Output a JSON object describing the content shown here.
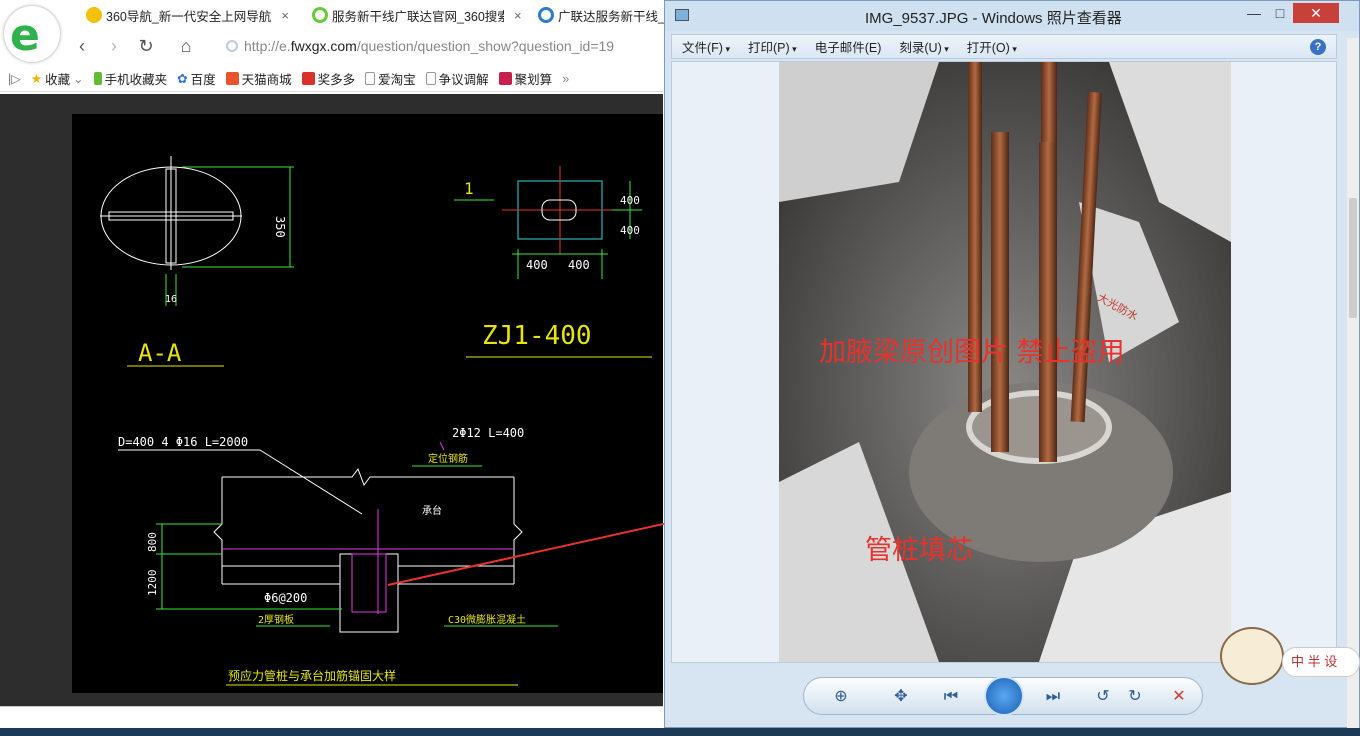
{
  "browser": {
    "tabs": [
      {
        "label": "360导航_新一代安全上网导航",
        "close": "×"
      },
      {
        "label": "服务新干线广联达官网_360搜索",
        "close": "×"
      },
      {
        "label": "广联达服务新干线_"
      }
    ],
    "address": {
      "prefix": "http://e.",
      "domain": "fwxgx.com",
      "path": "/question/question_show?question_id=19"
    },
    "bookmarks": [
      "收藏",
      "手机收藏夹",
      "百度",
      "天猫商城",
      "奖多多",
      "爱淘宝",
      "争议调解",
      "聚划算"
    ],
    "more": "»"
  },
  "cad": {
    "section_dim": "350",
    "section_width": "16",
    "section_label": "A-A",
    "marker_1": "1",
    "dims_v": [
      "400",
      "400"
    ],
    "dims_h": [
      "400",
      "400"
    ],
    "zj_label": "ZJ1-400",
    "pile_note": "D=400 4 Φ16 L=2000",
    "rebar_note": "2Φ12 L=400",
    "position_rebar": "定位钢筋",
    "cap_label": "承台",
    "h800": "800",
    "h1200": "1200",
    "stirrup": "Φ6@200",
    "plate": "2厚钢板",
    "concrete": "C30微膨胀混凝土",
    "detail_title": "预应力管桩与承台加筋锚固大样"
  },
  "viewer": {
    "title": "IMG_9537.JPG - Windows 照片查看器",
    "window_controls": {
      "min": "—",
      "max": "□",
      "close": "✕"
    },
    "menu": [
      "文件(F)",
      "打印(P)",
      "电子邮件(E)",
      "刻录(U)",
      "打开(O)"
    ],
    "help": "?",
    "watermark": "加腋梁原创图片   禁止盗用",
    "photo_label": "管桩填芯",
    "photo_sticker": "大光防水"
  },
  "mascot": {
    "text": "中 半 设"
  },
  "colors": {
    "annotation_red": "#e8322b",
    "cad_green": "#39e639",
    "cad_yellow": "#e6e600",
    "cad_magenta": "#e23ae2",
    "cad_cyan": "#33d6d6"
  }
}
